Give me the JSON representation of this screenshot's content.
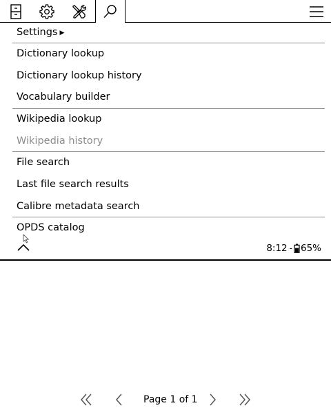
{
  "tabs": [
    {
      "icon": "file-cabinet-icon"
    },
    {
      "icon": "gear-icon"
    },
    {
      "icon": "tools-icon"
    },
    {
      "icon": "search-icon",
      "active": true
    },
    {
      "icon": "hamburger-menu-icon"
    }
  ],
  "menu": {
    "settings_label": "Settings",
    "items": [
      "Dictionary lookup",
      "Dictionary lookup history",
      "Vocabulary builder",
      "Wikipedia lookup",
      "Wikipedia history",
      "File search",
      "Last file search results",
      "Calibre metadata search",
      "OPDS catalog"
    ],
    "disabled_items": [
      "Wikipedia history"
    ]
  },
  "status": {
    "time": "8:12",
    "separator": "-",
    "battery": "65%"
  },
  "pager": {
    "label": "Page 1 of 1"
  },
  "colors": {
    "disabled_text": "#8c8c8c",
    "separator": "#8a8a8a"
  }
}
